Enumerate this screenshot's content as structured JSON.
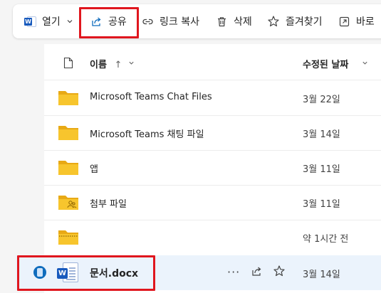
{
  "toolbar": {
    "open_label": "열기",
    "share_label": "공유",
    "copy_link_label": "링크 복사",
    "delete_label": "삭제",
    "favorite_label": "즐겨찾기",
    "shortcut_label": "바로"
  },
  "table": {
    "col_name": "이름",
    "sort_arrow": "↑",
    "col_modified": "수정된 날짜",
    "rows": [
      {
        "name": "Microsoft Teams Chat Files",
        "date": "3월 22일",
        "icon": "folder-icon"
      },
      {
        "name": "Microsoft Teams 채팅 파일",
        "date": "3월 14일",
        "icon": "folder-icon"
      },
      {
        "name": "앱",
        "date": "3월 11일",
        "icon": "folder-icon"
      },
      {
        "name": "첨부 파일",
        "date": "3월 11일",
        "icon": "shared-folder-icon"
      },
      {
        "name": "",
        "date": "약 1시간 전",
        "icon": "zip-folder-icon"
      },
      {
        "name": "문서.docx",
        "date": "3월 14일",
        "icon": "word-document-icon",
        "selected": true
      }
    ]
  },
  "row_actions": {
    "more": "···"
  },
  "colors": {
    "highlight": "#e0161e",
    "folder": "#f7c52d",
    "word_blue": "#185abd",
    "selected_bg": "#ebf3fc"
  }
}
